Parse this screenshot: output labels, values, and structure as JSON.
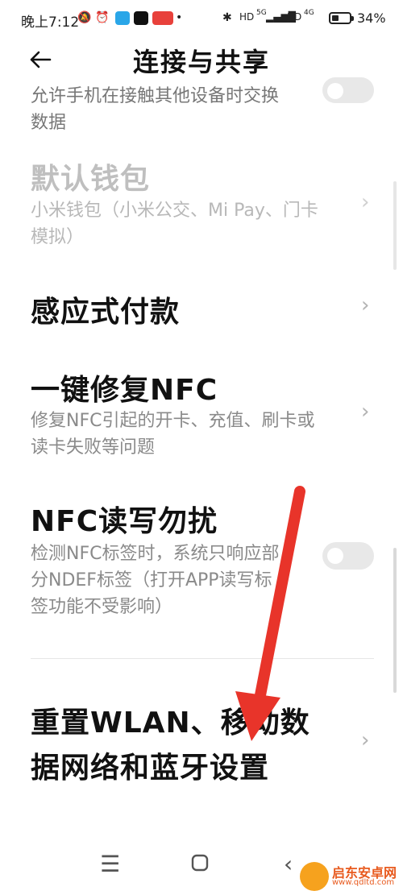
{
  "status_bar": {
    "time": "晚上7:12",
    "net_5g": "5G",
    "net_4g": "4G",
    "hd": "HD",
    "battery_percent": "34%",
    "battery_level": 0.34
  },
  "header": {
    "back_icon": "arrow-left-icon",
    "title": "连接与共享"
  },
  "items": [
    {
      "title": "",
      "subtitle_lines": [
        "允许手机在接触其他设备时交换",
        "数据"
      ],
      "control": "toggle",
      "state": "off"
    },
    {
      "title": "默认钱包",
      "subtitle_lines": [
        "小米钱包（小米公交、Mi Pay、门卡",
        "模拟）"
      ],
      "control": "chevron",
      "disabled": true
    },
    {
      "title": "感应式付款",
      "subtitle_lines": [],
      "control": "chevron"
    },
    {
      "title": "一键修复NFC",
      "subtitle_lines": [
        "修复NFC引起的开卡、充值、刷卡或",
        "读卡失败等问题"
      ],
      "control": "chevron"
    },
    {
      "title": "NFC读写勿扰",
      "subtitle_lines": [
        "检测NFC标签时，系统只响应部",
        "分NDEF标签（打开APP读写标",
        "签功能不受影响）"
      ],
      "control": "toggle",
      "state": "off"
    },
    {
      "title_lines": [
        "重置WLAN、移动数",
        "据网络和蓝牙设置"
      ],
      "control": "chevron"
    }
  ],
  "watermark": {
    "brand": "启东安卓网",
    "url": "www.qdltd.com"
  },
  "colors": {
    "annotation_arrow": "#e8342a",
    "toggle_off": "#e8e8e8",
    "subtitle": "#8a8a8a"
  }
}
